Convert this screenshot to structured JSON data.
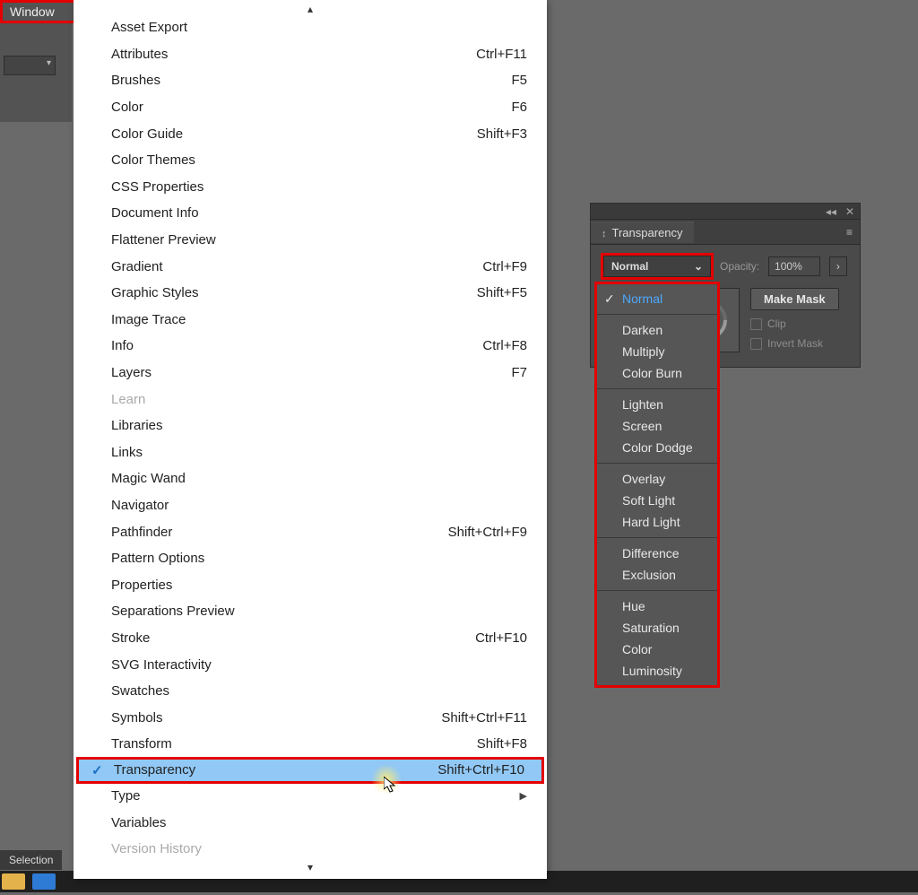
{
  "menubar": {
    "window_label": "Window"
  },
  "selection_label": "Selection",
  "window_menu": {
    "items": [
      {
        "label": "Asset Export",
        "shortcut": ""
      },
      {
        "label": "Attributes",
        "shortcut": "Ctrl+F11"
      },
      {
        "label": "Brushes",
        "shortcut": "F5"
      },
      {
        "label": "Color",
        "shortcut": "F6"
      },
      {
        "label": "Color Guide",
        "shortcut": "Shift+F3"
      },
      {
        "label": "Color Themes",
        "shortcut": ""
      },
      {
        "label": "CSS Properties",
        "shortcut": ""
      },
      {
        "label": "Document Info",
        "shortcut": ""
      },
      {
        "label": "Flattener Preview",
        "shortcut": ""
      },
      {
        "label": "Gradient",
        "shortcut": "Ctrl+F9"
      },
      {
        "label": "Graphic Styles",
        "shortcut": "Shift+F5"
      },
      {
        "label": "Image Trace",
        "shortcut": ""
      },
      {
        "label": "Info",
        "shortcut": "Ctrl+F8"
      },
      {
        "label": "Layers",
        "shortcut": "F7"
      },
      {
        "label": "Learn",
        "shortcut": "",
        "disabled": true
      },
      {
        "label": "Libraries",
        "shortcut": ""
      },
      {
        "label": "Links",
        "shortcut": ""
      },
      {
        "label": "Magic Wand",
        "shortcut": ""
      },
      {
        "label": "Navigator",
        "shortcut": ""
      },
      {
        "label": "Pathfinder",
        "shortcut": "Shift+Ctrl+F9"
      },
      {
        "label": "Pattern Options",
        "shortcut": ""
      },
      {
        "label": "Properties",
        "shortcut": ""
      },
      {
        "label": "Separations Preview",
        "shortcut": ""
      },
      {
        "label": "Stroke",
        "shortcut": "Ctrl+F10"
      },
      {
        "label": "SVG Interactivity",
        "shortcut": ""
      },
      {
        "label": "Swatches",
        "shortcut": ""
      },
      {
        "label": "Symbols",
        "shortcut": "Shift+Ctrl+F11"
      },
      {
        "label": "Transform",
        "shortcut": "Shift+F8"
      },
      {
        "label": "Transparency",
        "shortcut": "Shift+Ctrl+F10",
        "highlight": true,
        "checked": true
      },
      {
        "label": "Type",
        "shortcut": "",
        "submenu": true
      },
      {
        "label": "Variables",
        "shortcut": ""
      },
      {
        "label": "Version History",
        "shortcut": "",
        "disabled": true
      }
    ]
  },
  "panel": {
    "tab_label": "Transparency",
    "opacity_label": "Opacity:",
    "opacity_value": "100%",
    "make_mask": "Make Mask",
    "clip": "Clip",
    "invert": "Invert Mask",
    "blend_selected": "Normal"
  },
  "blend_modes": {
    "groups": [
      [
        {
          "label": "Normal",
          "selected": true
        }
      ],
      [
        {
          "label": "Darken"
        },
        {
          "label": "Multiply"
        },
        {
          "label": "Color Burn"
        }
      ],
      [
        {
          "label": "Lighten"
        },
        {
          "label": "Screen"
        },
        {
          "label": "Color Dodge"
        }
      ],
      [
        {
          "label": "Overlay"
        },
        {
          "label": "Soft Light"
        },
        {
          "label": "Hard Light"
        }
      ],
      [
        {
          "label": "Difference"
        },
        {
          "label": "Exclusion"
        }
      ],
      [
        {
          "label": "Hue"
        },
        {
          "label": "Saturation"
        },
        {
          "label": "Color"
        },
        {
          "label": "Luminosity"
        }
      ]
    ]
  }
}
